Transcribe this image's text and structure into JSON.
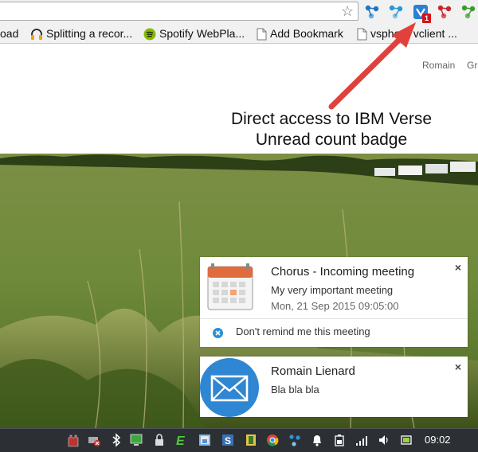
{
  "browser": {
    "bookmarks": [
      {
        "label": "oad",
        "icon": "bookmark-cut-icon"
      },
      {
        "label": "Splitting a recor...",
        "icon": "headphones-icon"
      },
      {
        "label": "Spotify WebPla...",
        "icon": "spotify-icon"
      },
      {
        "label": "Add Bookmark",
        "icon": "page-icon"
      },
      {
        "label": "vsphere vclient ...",
        "icon": "page-icon"
      }
    ],
    "extension_badge": "1"
  },
  "page": {
    "user_links": [
      "Romain",
      "Gr"
    ]
  },
  "callout": {
    "line1": "Direct access to IBM Verse",
    "line2": "Unread count badge"
  },
  "notifications": {
    "meeting": {
      "title": "Chorus - Incoming meeting",
      "subject": "My very important meeting",
      "time": "Mon, 21 Sep 2015 09:05:00",
      "action": "Don't remind me this meeting"
    },
    "mail": {
      "sender": "Romain Lienard",
      "body": "Bla bla bla"
    },
    "close_glyph": "×"
  },
  "taskbar": {
    "clock": "09:02"
  },
  "colors": {
    "arrow": "#e0413a",
    "taskbar": "#2c2f33",
    "mail_icon_bg": "#2f86d2",
    "badge": "#d7121b",
    "sky_green": "#6b8f3a"
  }
}
